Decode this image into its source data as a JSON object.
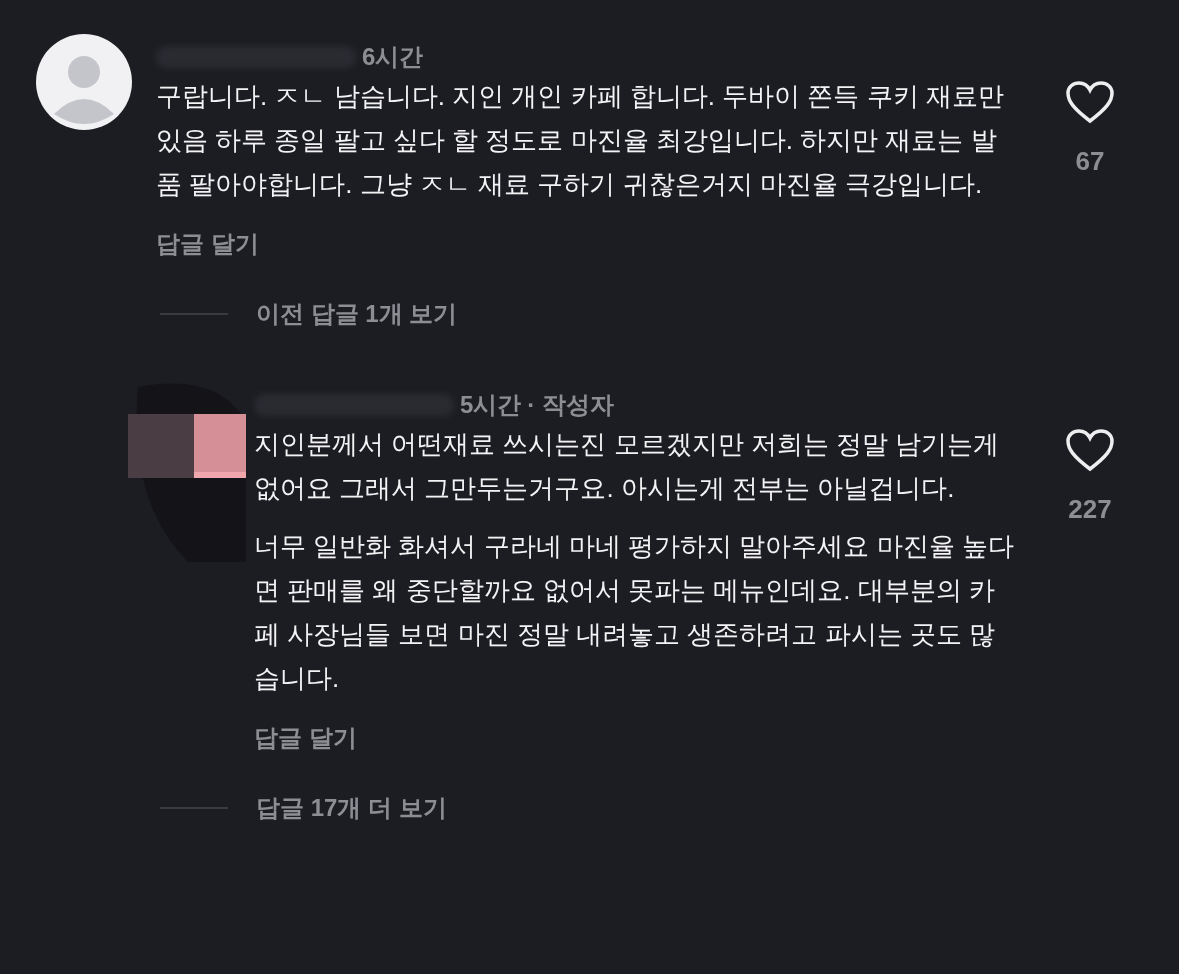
{
  "comments": [
    {
      "kind": "comment",
      "time": "6시간",
      "paragraphs": [
        "구랍니다. ㅈㄴ 남습니다. 지인 개인 카페 합니다. 두바이 쫀득 쿠키 재료만 있음 하루 종일 팔고 싶다 할 정도로 마진율 최강입니다. 하지만 재료는 발품 팔아야합니다. 그냥 ㅈㄴ 재료 구하기 귀찮은거지 마진율 극강입니다."
      ],
      "liked": false,
      "likes": "67",
      "reply_label": "답글 달기",
      "more_replies": "이전 답글 **1**개 보기"
    },
    {
      "kind": "reply",
      "time": "5시간",
      "author_tag": "· 작성자",
      "paragraphs": [
        "지인분께서 어떤재료 쓰시는진 모르겠지만 저희는 정말 남기는게 없어요 그래서 그만두는거구요. 아시는게 전부는 아닐겁니다.",
        "너무 일반화 화셔서 구라네 마네 평가하지 말아주세요 마진율 높다면 판매를 왜 중단할까요 없어서 못파는 메뉴인데요. 대부분의 카페 사장님들 보면 마진 정말 내려놓고 생존하려고 파시는 곳도 많습니다."
      ],
      "liked": false,
      "likes": "227",
      "reply_label": "답글 달기",
      "more_replies": "답글 **17**개 더 보기"
    }
  ]
}
